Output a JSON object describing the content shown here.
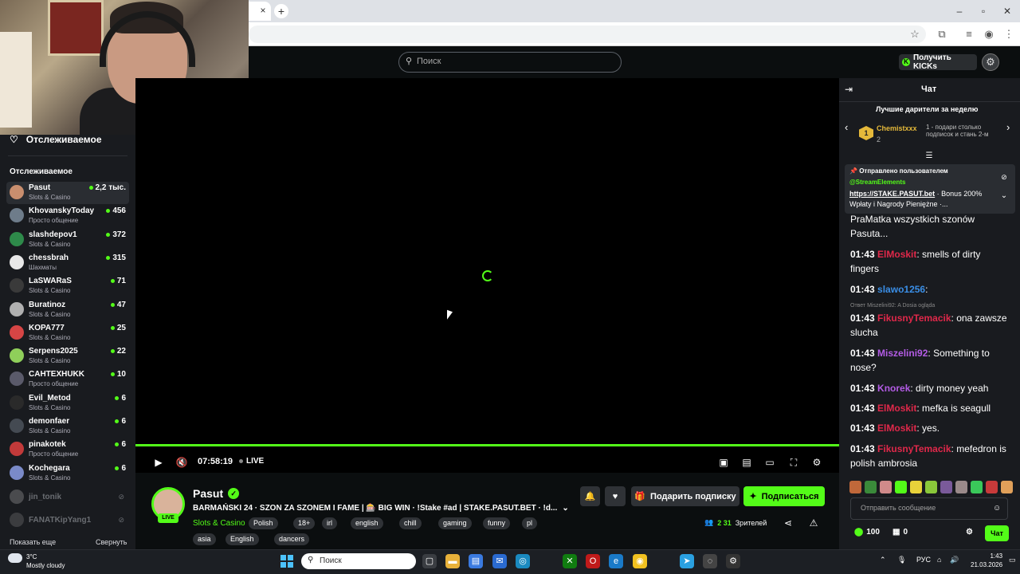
{
  "browser": {
    "tab_close": "×",
    "new_tab": "+"
  },
  "header": {
    "search_placeholder": "Поиск",
    "kicks_label": "Получить KICKs"
  },
  "sidebar": {
    "top_label": "Отслеживаемое",
    "heading": "Отслеживаемое",
    "items": [
      {
        "name": "Pasut",
        "category": "Slots & Casino",
        "viewers": "2,2 тыс.",
        "color": "#c98e6e"
      },
      {
        "name": "KhovanskyToday",
        "category": "Просто общение",
        "viewers": "456",
        "color": "#6e7c8a"
      },
      {
        "name": "slashdepov1",
        "category": "Slots & Casino",
        "viewers": "372",
        "color": "#2e8a4a"
      },
      {
        "name": "chessbrah",
        "category": "Шахматы",
        "viewers": "315",
        "color": "#e8e8e8"
      },
      {
        "name": "LaSWARaS",
        "category": "Slots & Casino",
        "viewers": "71",
        "color": "#3a3a3a"
      },
      {
        "name": "Buratinoz",
        "category": "Slots & Casino",
        "viewers": "47",
        "color": "#b0b0b0"
      },
      {
        "name": "KOPA777",
        "category": "Slots & Casino",
        "viewers": "25",
        "color": "#d64545"
      },
      {
        "name": "Serpens2025",
        "category": "Slots & Casino",
        "viewers": "22",
        "color": "#8fcf5a"
      },
      {
        "name": "CAHTEXHUKK",
        "category": "Просто общение",
        "viewers": "10",
        "color": "#5a5a6a"
      },
      {
        "name": "Evil_Metod",
        "category": "Slots & Casino",
        "viewers": "6",
        "color": "#2a2a2a"
      },
      {
        "name": "demonfaer",
        "category": "Slots & Casino",
        "viewers": "6",
        "color": "#444a52"
      },
      {
        "name": "pinakotek",
        "category": "Просто общение",
        "viewers": "6",
        "color": "#c23a3a"
      },
      {
        "name": "Kochegara",
        "category": "Slots & Casino",
        "viewers": "6",
        "color": "#7a8ac8"
      }
    ],
    "offline": [
      {
        "name": "jin_tonik",
        "color": "#888"
      },
      {
        "name": "FANATKipYang1",
        "color": "#666"
      }
    ],
    "show_more": "Показать еще",
    "collapse": "Свернуть"
  },
  "player": {
    "time": "07:58:19",
    "live": "LIVE"
  },
  "stream": {
    "channel": "Pasut",
    "live_badge": "LIVE",
    "title": "BARMAŃSKI 24 · SZON ZA SZONEM I FAME | 🎰 BIG WIN · !Stake #ad | STAKE.PASUT.BET · !d...",
    "category": "Slots & Casino",
    "tags": [
      "Polish",
      "18+",
      "irl",
      "english",
      "chill",
      "gaming",
      "funny",
      "pl",
      "asia",
      "English",
      "dancers"
    ],
    "gift_sub_label": "Подарить подписку",
    "subscribe_label": "Подписаться",
    "viewers_num": "2 31",
    "viewers_label": "Зрителей"
  },
  "chat": {
    "title": "Чат",
    "gifters_title": "Лучшие дарители за неделю",
    "top_gifter": {
      "rank": "1",
      "name": "Chemistxxx",
      "count": "2"
    },
    "promo": "1 - подари столько подписок и стань 2-м",
    "pinned": {
      "header": "Отправлено пользователем",
      "user": "@StreamElements",
      "link": "https://STAKE.PASUT.bet",
      "text": " · Bonus 200% Wpłaty i Nagrody Pieniężne ·..."
    },
    "messages": [
      {
        "time": "",
        "user": "",
        "color": "#fff",
        "text": "PraMatka wszystkich szonów Pasuta..."
      },
      {
        "time": "01:43",
        "user": "ElMoskit",
        "color": "#e0284a",
        "text": ": smells of dirty fingers"
      },
      {
        "time": "01:43",
        "user": "slawo1256",
        "color": "#3a8ee6",
        "text": ":"
      },
      {
        "time": "01:43",
        "user": "FikusnyTemacik",
        "color": "#e0284a",
        "text": ": ona zawsze slucha"
      },
      {
        "time": "01:43",
        "user": "Miszelini92",
        "color": "#b45ce6",
        "text": ": Something to nose?"
      },
      {
        "time": "01:43",
        "user": "Knorek",
        "color": "#b45ce6",
        "text": ": dirty money yeah"
      },
      {
        "time": "01:43",
        "user": "ElMoskit",
        "color": "#e0284a",
        "text": ": mefka is seagull"
      },
      {
        "time": "01:43",
        "user": "ElMoskit",
        "color": "#e0284a",
        "text": ": yes."
      },
      {
        "time": "01:43",
        "user": "FikusnyTemacik",
        "color": "#e0284a",
        "text": ": mefedron is polish ambrosia"
      }
    ],
    "reply_hint": "Ответ Miszelini92: A Dosia ogląda",
    "input_placeholder": "Отправить сообщение",
    "points": "100",
    "other_count": "0",
    "send_label": "Чат"
  },
  "taskbar": {
    "temp": "3°C",
    "weather": "Mostly cloudy",
    "search": "Поиск",
    "lang": "РУС",
    "time": "1:43",
    "date": "21.03.2026"
  }
}
